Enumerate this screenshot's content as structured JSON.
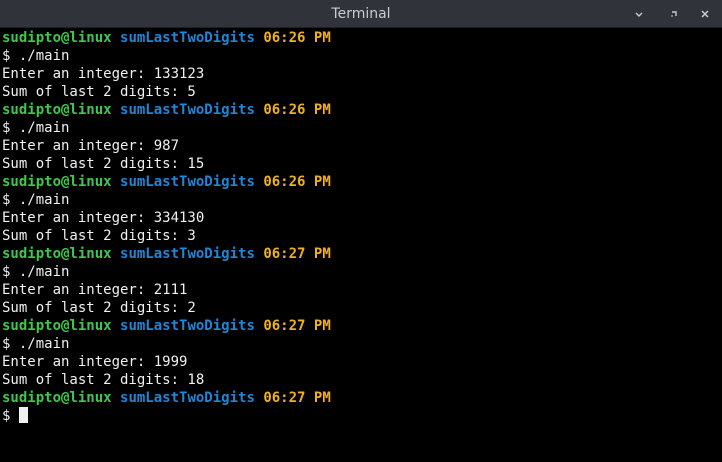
{
  "window": {
    "title": "Terminal"
  },
  "prompt": {
    "dollar": "$ "
  },
  "sessions": [
    {
      "user": "sudipto@linux",
      "dir": "sumLastTwoDigits",
      "time": "06:26 PM",
      "command": "./main",
      "input_line": "Enter an integer: 133123",
      "output_line": "Sum of last 2 digits: 5"
    },
    {
      "user": "sudipto@linux",
      "dir": "sumLastTwoDigits",
      "time": "06:26 PM",
      "command": "./main",
      "input_line": "Enter an integer: 987",
      "output_line": "Sum of last 2 digits: 15"
    },
    {
      "user": "sudipto@linux",
      "dir": "sumLastTwoDigits",
      "time": "06:26 PM",
      "command": "./main",
      "input_line": "Enter an integer: 334130",
      "output_line": "Sum of last 2 digits: 3"
    },
    {
      "user": "sudipto@linux",
      "dir": "sumLastTwoDigits",
      "time": "06:27 PM",
      "command": "./main",
      "input_line": "Enter an integer: 2111",
      "output_line": "Sum of last 2 digits: 2"
    },
    {
      "user": "sudipto@linux",
      "dir": "sumLastTwoDigits",
      "time": "06:27 PM",
      "command": "./main",
      "input_line": "Enter an integer: 1999",
      "output_line": "Sum of last 2 digits: 18"
    }
  ],
  "current": {
    "user": "sudipto@linux",
    "dir": "sumLastTwoDigits",
    "time": "06:27 PM"
  },
  "colors": {
    "user": "#3ec94b",
    "directory": "#1f86d8",
    "time": "#f0b11e",
    "text": "#f0f0f0",
    "background": "#000000",
    "titlebar": "#30343a"
  },
  "icons": [
    "minimize-icon",
    "maximize-icon",
    "close-icon"
  ]
}
